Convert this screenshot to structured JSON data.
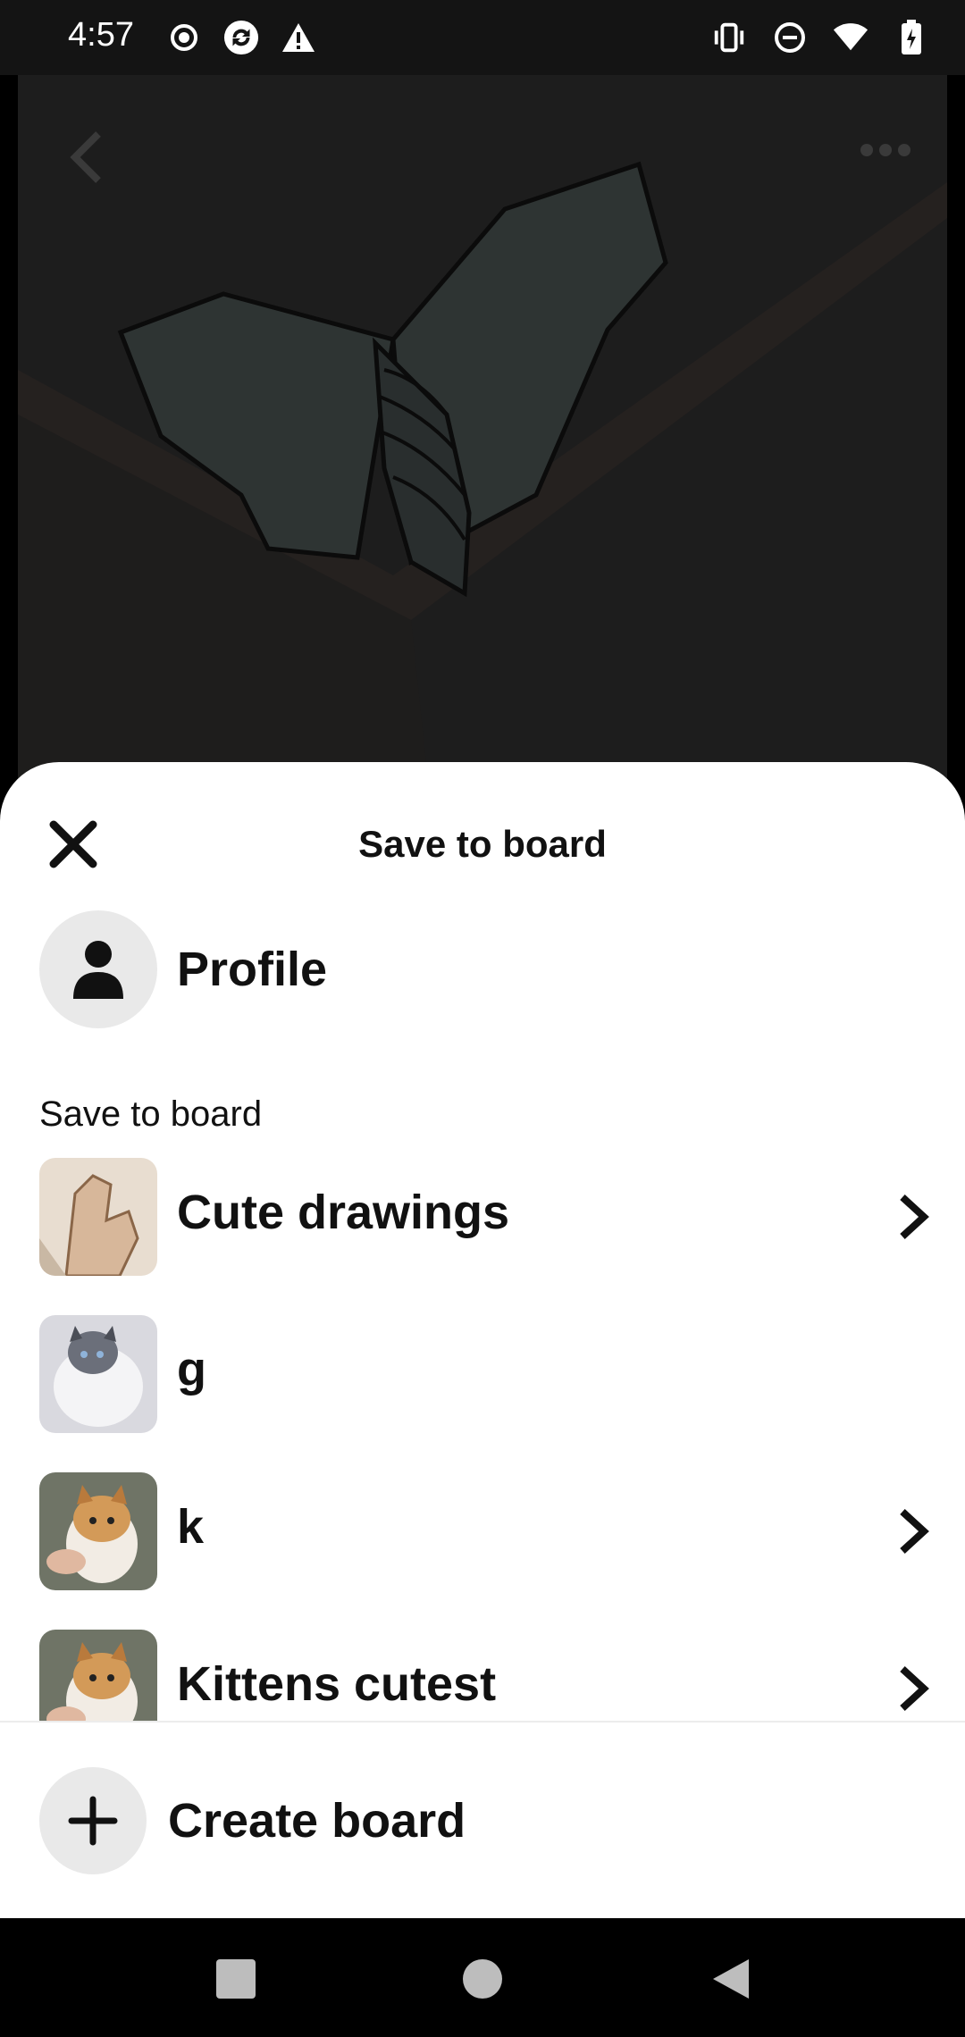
{
  "status_bar": {
    "time": "4:57",
    "left_icons": [
      "record-icon",
      "sync-icon",
      "warning-icon"
    ],
    "right_icons": [
      "vibrate-icon",
      "do-not-disturb-icon",
      "wifi-icon",
      "battery-charging-icon"
    ]
  },
  "sheet": {
    "title": "Save to board",
    "profile_label": "Profile",
    "section_label": "Save to board",
    "boards": [
      {
        "name": "Cute drawings",
        "has_chevron": true
      },
      {
        "name": "g",
        "has_chevron": false
      },
      {
        "name": "k",
        "has_chevron": true
      },
      {
        "name": "Kittens cutest",
        "has_chevron": true
      }
    ],
    "create_label": "Create board"
  },
  "colors": {
    "sheet_bg": "#ffffff",
    "text": "#111111",
    "icon_circle_bg": "#e9e9e9"
  },
  "nav": {
    "icons": [
      "recents-square-icon",
      "home-circle-icon",
      "back-triangle-icon"
    ]
  }
}
